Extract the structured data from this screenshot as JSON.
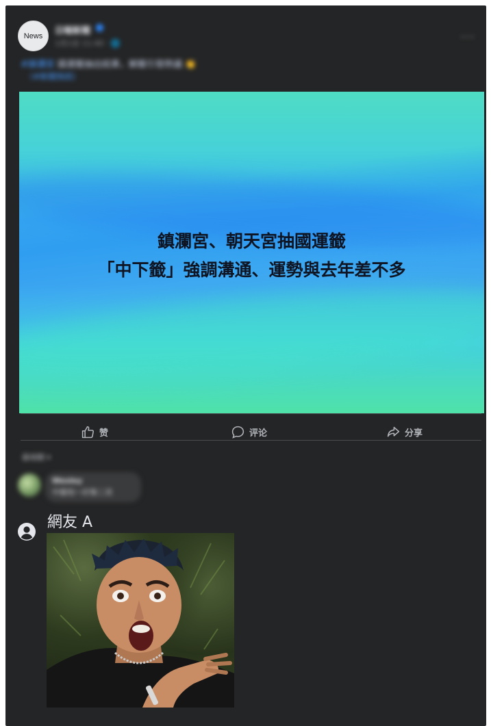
{
  "post": {
    "avatar_label": "News",
    "page_name": "日報新聞",
    "meta": "1月1日 11:40 · 🌐",
    "caption_link": "#鎮瀾宮",
    "caption_text": "國運籤抽出結果，解籤引發熱議 👏",
    "caption_line2": "（#新聞快訊）",
    "more_icon": "more-horizontal-icon"
  },
  "image": {
    "headline_line1": "鎮瀾宮、朝天宮抽國運籤",
    "headline_line2": "「中下籤」強調溝通、運勢與去年差不多"
  },
  "actions": {
    "like_label": "赞",
    "comment_label": "评论",
    "share_label": "分享"
  },
  "comments": {
    "sort_label": "最相關 ▾",
    "blurred_name": "Wesley",
    "blurred_text": "中籤啦～好像二流",
    "netizen_name": "網友 A"
  },
  "colors": {
    "card_bg": "#242526",
    "text_primary": "#e4e6eb",
    "text_secondary": "#b0b3b8",
    "link": "#4599ff"
  }
}
